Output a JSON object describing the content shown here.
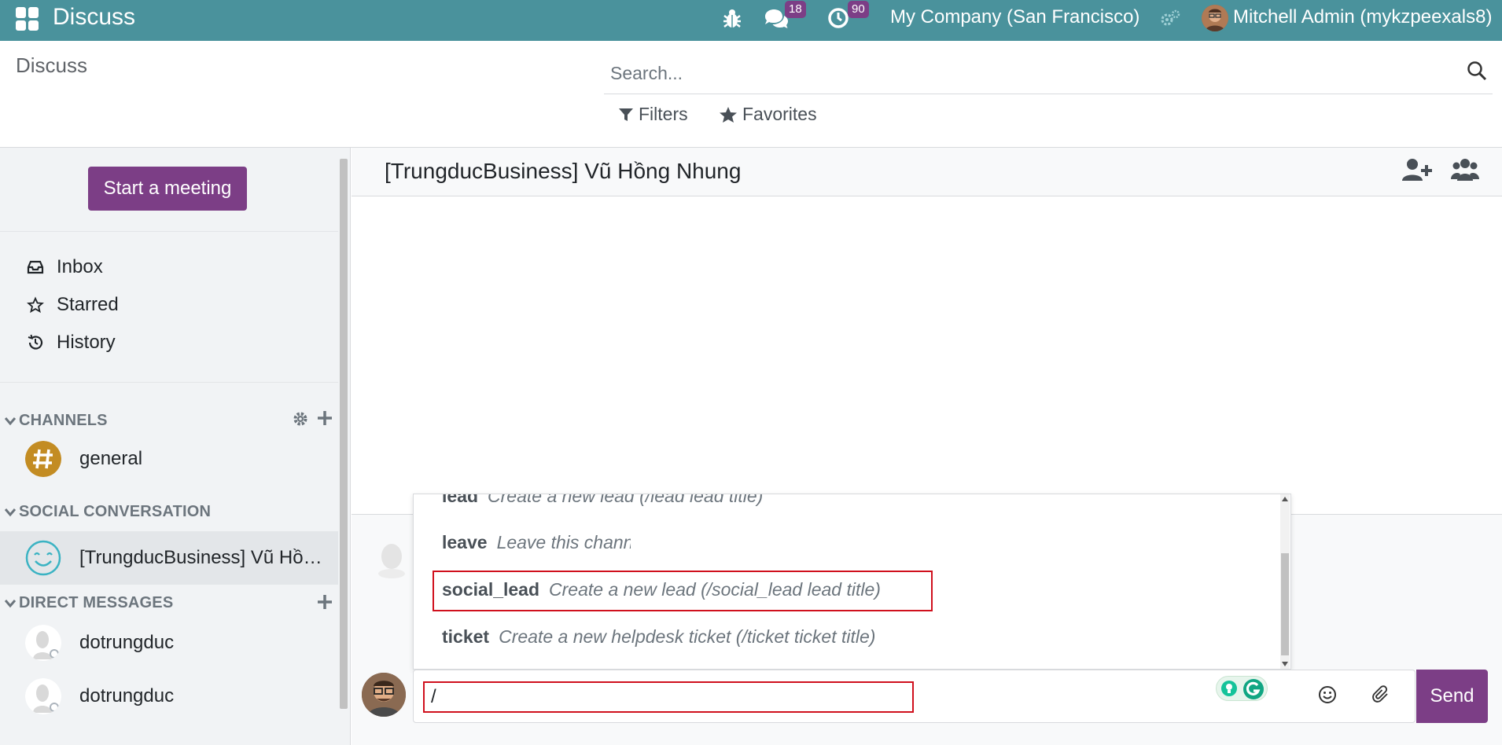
{
  "colors": {
    "navbar": "#4a929c",
    "primary": "#7c3e86",
    "highlight_border": "#d0101d",
    "channel_icon": "#c38c23",
    "social_icon": "#3bb3c3"
  },
  "navbar": {
    "app_name": "Discuss",
    "messages_badge": "18",
    "activities_badge": "90",
    "company": "My Company (San Francisco)",
    "user": "Mitchell Admin (mykzpeexals8)",
    "icons": [
      "apps-grid-icon",
      "bug-icon",
      "chat-icon",
      "clock-icon",
      "settings-gears-icon"
    ]
  },
  "control_panel": {
    "title": "Discuss",
    "search_placeholder": "Search...",
    "filters_label": "Filters",
    "favorites_label": "Favorites"
  },
  "sidebar": {
    "start_meeting": "Start a meeting",
    "nav": [
      {
        "label": "Inbox",
        "icon": "inbox-icon"
      },
      {
        "label": "Starred",
        "icon": "star-icon"
      },
      {
        "label": "History",
        "icon": "history-icon"
      }
    ],
    "categories": {
      "channels": "CHANNELS",
      "social": "SOCIAL CONVERSATION",
      "direct": "DIRECT MESSAGES"
    },
    "channels": [
      {
        "label": "general"
      }
    ],
    "social": [
      {
        "label": "[TrungducBusiness] Vũ Hồng Nhung"
      }
    ],
    "direct": [
      {
        "label": "dotrungduc"
      },
      {
        "label": "dotrungduc"
      }
    ]
  },
  "thread": {
    "title": "[TrungducBusiness] Vũ Hồng Nhung"
  },
  "suggestions": [
    {
      "command": "lead",
      "description": "Create a new lead (/lead lead title)"
    },
    {
      "command": "leave",
      "description": "Leave this channel"
    },
    {
      "command": "social_lead",
      "description": "Create a new lead (/social_lead lead title)"
    },
    {
      "command": "ticket",
      "description": "Create a new helpdesk ticket (/ticket ticket title)"
    }
  ],
  "composer": {
    "value": "/",
    "send_label": "Send"
  }
}
